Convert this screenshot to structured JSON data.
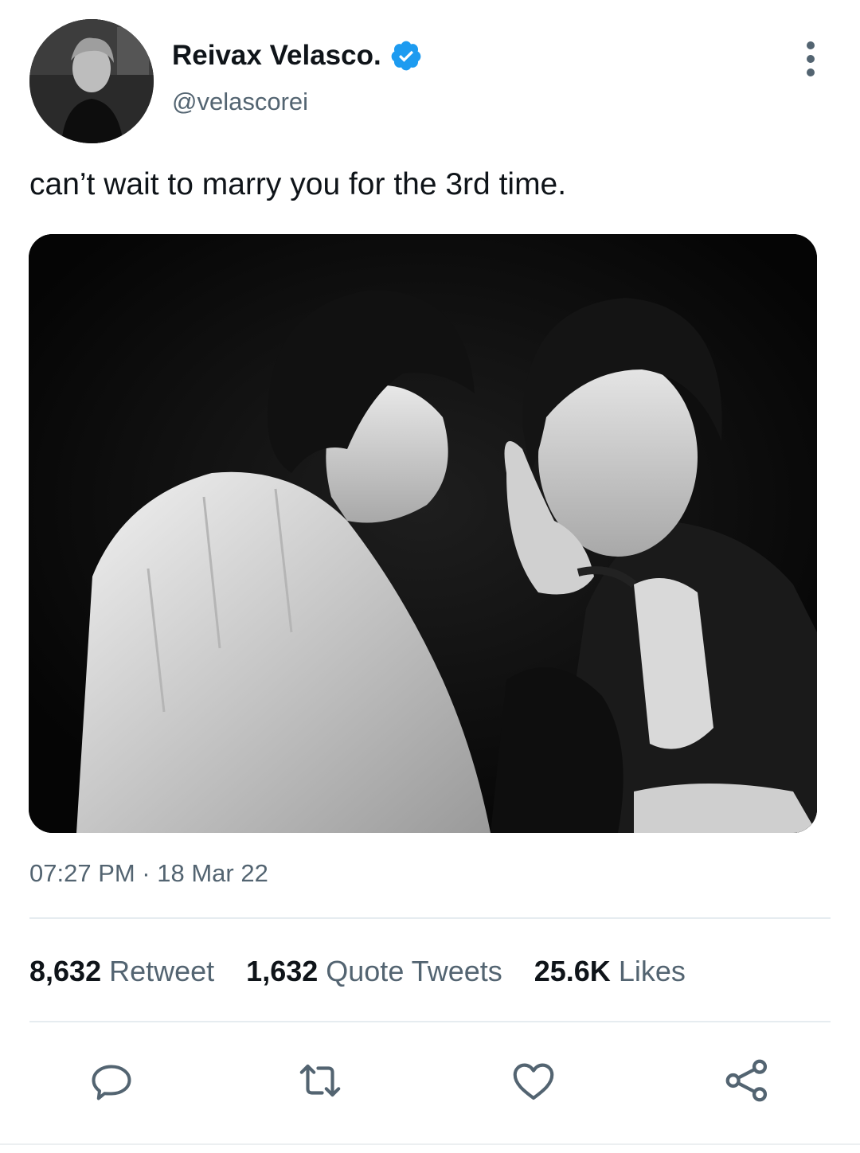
{
  "author": {
    "display_name": "Reivax Velasco.",
    "handle": "@velascorei",
    "verified": true
  },
  "tweet": {
    "text": "can’t wait to marry you for the 3rd time.",
    "timestamp": "07:27 PM · 18 Mar 22"
  },
  "stats": {
    "retweets": {
      "count": "8,632",
      "label": "Retweet"
    },
    "quotes": {
      "count": "1,632",
      "label": "Quote Tweets"
    },
    "likes": {
      "count": "25.6K",
      "label": "Likes"
    }
  },
  "actions": {
    "reply_icon": "reply-icon",
    "retweet_icon": "retweet-icon",
    "like_icon": "heart-icon",
    "share_icon": "share-icon"
  },
  "colors": {
    "text_primary": "#0f1419",
    "text_secondary": "#536471",
    "verified_blue": "#1d9bf0",
    "divider": "#e6ecf0"
  }
}
